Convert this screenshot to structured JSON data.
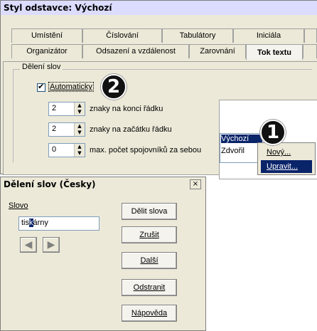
{
  "main_dialog": {
    "title": "Styl odstavce: Výchozí",
    "tabs_row1": [
      "Umístění",
      "Číslování",
      "Tabulátory",
      "Iniciála"
    ],
    "tabs_row2": [
      "Organizátor",
      "Odsazení a vzdálenost",
      "Zarovnání",
      "Tok textu"
    ],
    "active_tab": "Tok textu",
    "group_label": "Dělení slov",
    "auto_checkbox_label": "Automaticky",
    "auto_checked": true,
    "spinners": [
      {
        "value": "2",
        "label": "znaky na konci řádku"
      },
      {
        "value": "2",
        "label": "znaky na začátku řádku"
      },
      {
        "value": "0",
        "label": "max. počet spojovníků za sebou"
      }
    ]
  },
  "badges": {
    "one": "1",
    "two": "2"
  },
  "style_popup": {
    "items": [
      "Výchozí",
      "Zdvořil"
    ],
    "menu_items": [
      "Nový...",
      "Upravit..."
    ],
    "selected_menu": "Upravit..."
  },
  "hyphenation_dialog": {
    "title": "Dělení slov (Česky)",
    "word_label": "Slovo",
    "word_value_before": "tis",
    "word_value_sel": "k",
    "word_value_after": "árny",
    "close_symbol": "×",
    "buttons": [
      "Dělit slova",
      "Zrušit",
      "Další",
      "Odstranit",
      "Nápověda"
    ]
  },
  "colors": {
    "titlebar": "#dcdcff",
    "dialog_bg": "#ece9d8",
    "selection": "#0a246a"
  }
}
